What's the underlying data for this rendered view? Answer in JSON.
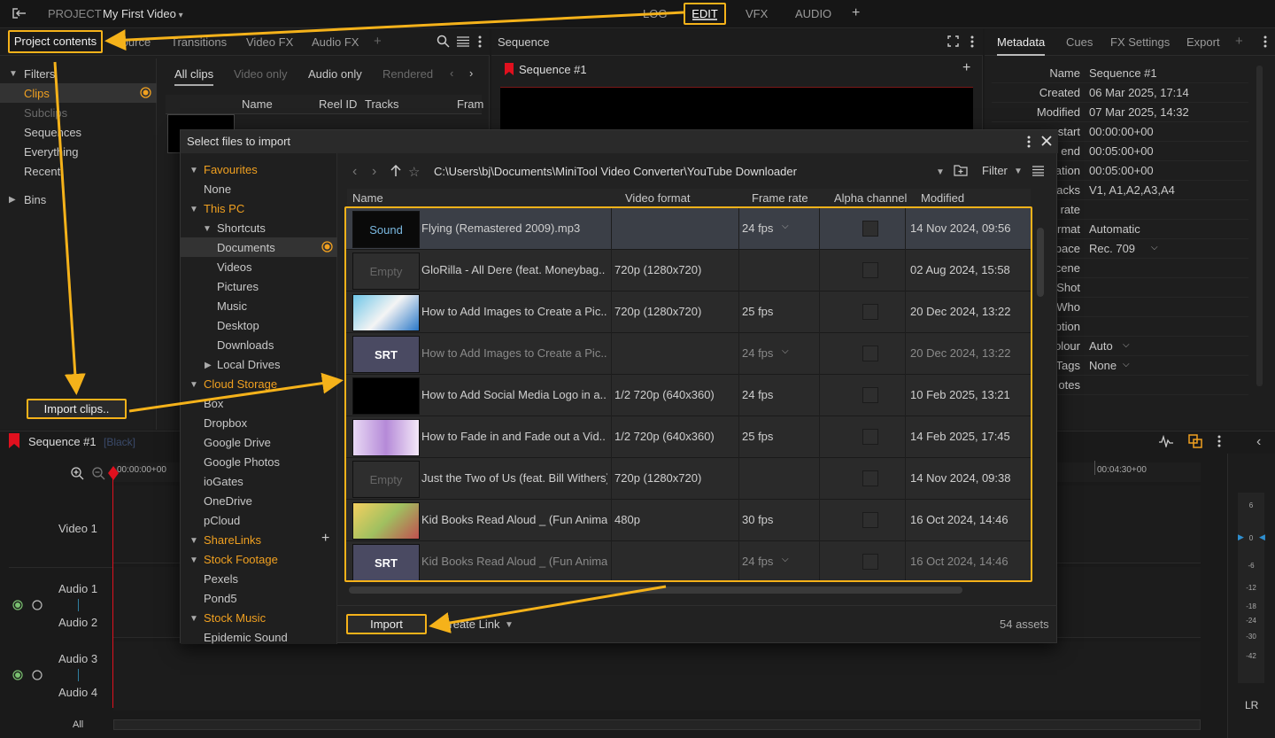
{
  "topbar": {
    "project_label": "PROJECT",
    "project_name": "My First Video",
    "modes": [
      "LOG",
      "EDIT",
      "VFX",
      "AUDIO"
    ],
    "add": "+"
  },
  "left_panel": {
    "tabs": [
      "Project contents",
      "Source",
      "Transitions",
      "Video FX",
      "Audio FX"
    ],
    "filters_label": "Filters",
    "filters": [
      "Clips",
      "Subclips",
      "Sequences",
      "Everything",
      "Recent"
    ],
    "bins_label": "Bins",
    "subtabs": [
      "All clips",
      "Video only",
      "Audio only",
      "Rendered"
    ],
    "columns": [
      "Name",
      "Reel ID",
      "Tracks",
      "Fram"
    ],
    "import_clips": "Import clips.."
  },
  "sequence_panel": {
    "title": "Sequence",
    "sequence_name": "Sequence #1"
  },
  "metadata_panel": {
    "tabs": [
      "Metadata",
      "Cues",
      "FX Settings",
      "Export"
    ],
    "rows": [
      {
        "key": "Name",
        "value": "Sequence #1"
      },
      {
        "key": "Created",
        "value": "06 Mar 2025, 17:14"
      },
      {
        "key": "Modified",
        "value": "07 Mar 2025, 14:32"
      },
      {
        "key": "start",
        "value": "00:00:00+00"
      },
      {
        "key": "end",
        "value": "00:05:00+00"
      },
      {
        "key": "ation",
        "value": "00:05:00+00"
      },
      {
        "key": "acks",
        "value": "V1, A1,A2,A3,A4"
      },
      {
        "key": "rate",
        "value": ""
      },
      {
        "key": "rmat",
        "value": "Automatic"
      },
      {
        "key": "pace",
        "value": "Rec. 709"
      },
      {
        "key": "cene",
        "value": ""
      },
      {
        "key": "Shot",
        "value": ""
      },
      {
        "key": "Who",
        "value": ""
      },
      {
        "key": "ption",
        "value": ""
      },
      {
        "key": "olour",
        "value": "Auto"
      },
      {
        "key": "Tags",
        "value": "None"
      },
      {
        "key": "otes",
        "value": ""
      }
    ]
  },
  "timeline": {
    "sequence_name": "Sequence #1",
    "sequence_tag": "[Black]",
    "timecode_start": "00:00:00+00",
    "timecode_mark": "00:04:30+00",
    "tracks": [
      "Video 1",
      "Audio 1",
      "Audio 2",
      "Audio 3",
      "Audio 4"
    ],
    "all_label": "All",
    "meter_scale": [
      "6",
      "0",
      "-6",
      "-12",
      "-18",
      "-24",
      "-30",
      "-42"
    ],
    "lr_label": "LR"
  },
  "dialog": {
    "title": "Select files to import",
    "sidebar": {
      "favourites": "Favourites",
      "favourites_none": "None",
      "this_pc": "This PC",
      "shortcuts": "Shortcuts",
      "shortcut_items": [
        "Documents",
        "Videos",
        "Pictures",
        "Music",
        "Desktop",
        "Downloads"
      ],
      "local_drives": "Local Drives",
      "cloud_storage": "Cloud Storage",
      "cloud_items": [
        "Box",
        "Dropbox",
        "Google Drive",
        "Google Photos",
        "ioGates",
        "OneDrive",
        "pCloud"
      ],
      "sharelinks": "ShareLinks",
      "stock_footage": "Stock Footage",
      "stock_footage_items": [
        "Pexels",
        "Pond5"
      ],
      "stock_music": "Stock Music",
      "stock_music_items": [
        "Epidemic Sound"
      ]
    },
    "path": "C:\\Users\\bj\\Documents\\MiniTool Video Converter\\YouTube Downloader",
    "filter_label": "Filter",
    "columns": [
      "Name",
      "Video format",
      "Frame rate",
      "Alpha channel",
      "Modified"
    ],
    "files": [
      {
        "thumb": "Sound",
        "name": "Flying (Remastered 2009).mp3",
        "format": "",
        "fps": "24 fps",
        "fps_dropdown": true,
        "modified": "14 Nov 2024, 09:56",
        "dim": false
      },
      {
        "thumb": "Empty",
        "name": "GloRilla - All Dere (feat. Moneybag..",
        "format": "720p (1280x720)",
        "fps": "",
        "fps_dropdown": false,
        "modified": "02 Aug 2024, 15:58",
        "dim": false
      },
      {
        "thumb": "image",
        "name": "How to Add Images to Create a Pic..",
        "format": "720p (1280x720)",
        "fps": "25 fps",
        "fps_dropdown": false,
        "modified": "20 Dec 2024, 13:22",
        "dim": false
      },
      {
        "thumb": "SRT",
        "name": "How to Add Images to Create a Pic..",
        "format": "",
        "fps": "24 fps",
        "fps_dropdown": true,
        "modified": "20 Dec 2024, 13:22",
        "dim": true
      },
      {
        "thumb": "black",
        "name": "How to Add Social Media Logo in a..",
        "format": "1/2 720p (640x360)",
        "fps": "24 fps",
        "fps_dropdown": false,
        "modified": "10 Feb 2025, 13:21",
        "dim": false
      },
      {
        "thumb": "fade",
        "name": "How to Fade in and Fade out a Vid..",
        "format": "1/2 720p (640x360)",
        "fps": "25 fps",
        "fps_dropdown": false,
        "modified": "14 Feb 2025, 17:45",
        "dim": false
      },
      {
        "thumb": "Empty",
        "name": "Just the Two of Us (feat. Bill Withers)..",
        "format": "720p (1280x720)",
        "fps": "",
        "fps_dropdown": false,
        "modified": "14 Nov 2024, 09:38",
        "dim": false
      },
      {
        "thumb": "room",
        "name": "Kid Books Read Aloud _ (Fun Animal..",
        "format": "480p",
        "fps": "30 fps",
        "fps_dropdown": false,
        "modified": "16 Oct 2024, 14:46",
        "dim": false
      },
      {
        "thumb": "SRT",
        "name": "Kid Books Read Aloud _ (Fun Animal..",
        "format": "",
        "fps": "24 fps",
        "fps_dropdown": true,
        "modified": "16 Oct 2024, 14:46",
        "dim": true
      }
    ],
    "import_label": "Import",
    "create_link_label": "Create Link",
    "asset_count": "54 assets"
  },
  "colors": {
    "accent": "#f5b21a",
    "orange_text": "#f0a020",
    "playhead": "#e0101e"
  }
}
